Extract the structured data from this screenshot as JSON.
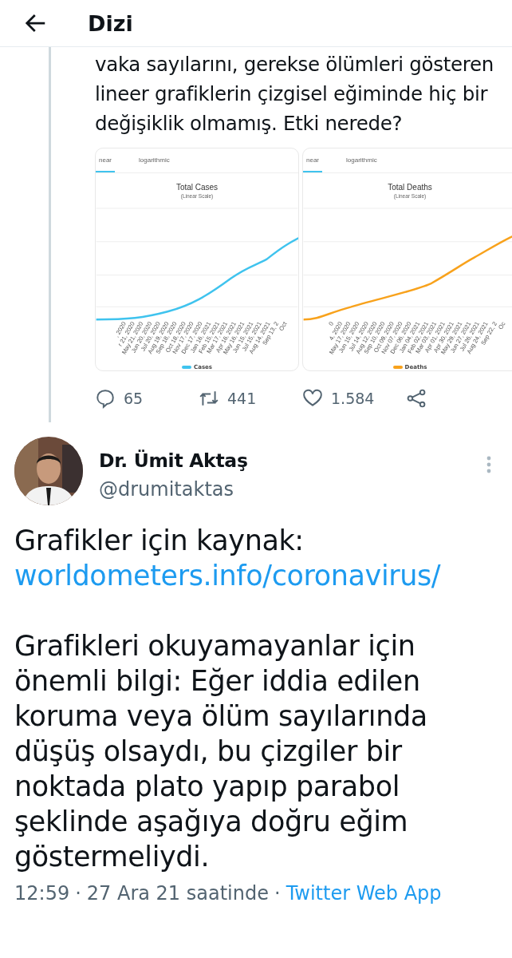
{
  "header": {
    "back_icon": true,
    "title": "Dizi"
  },
  "parent_tweet": {
    "text_lines": [
      "vaka sayılarını, gerekse ölümleri gösteren",
      "lineer grafiklerin çizgisel eğiminde hiç bir",
      "değişiklik olmamış.  Etki nerede?"
    ],
    "images": [
      {
        "tabs": [
          {
            "label": "near",
            "selected": true
          },
          {
            "label": "logarithmic",
            "selected": false
          }
        ],
        "title": "Total Cases",
        "subtitle": "(Linear Scale)",
        "color": "#3fc3ee",
        "dates": [
          ", 2020",
          "r 21, 2020",
          "May 21, 2020",
          "Jun 20, 2020",
          "Jul 20, 2020",
          "Aug 19, 2020",
          "Sep 18, 2020",
          "Oct 18, 2020",
          "Nov 17, 2020",
          "Dec 17, 2020",
          "Jan 16, 2021",
          "Feb 15, 2021",
          "Mar 17, 2021",
          "Apr 16, 2021",
          "May 16, 2021",
          "Jun 15, 2021",
          "Jul 15, 2021",
          "Aug 14, 2021",
          "Sep 13, 2",
          "Oct"
        ],
        "legend": "Cases"
      },
      {
        "tabs": [
          {
            "label": "near",
            "selected": true
          },
          {
            "label": "logarithmic",
            "selected": false
          }
        ],
        "title": "Total Deaths",
        "subtitle": "(Linear Scale)",
        "color": "#f8a21c",
        "dates": [
          "0",
          "4, 2020",
          "May 17, 2020",
          "Jun 15, 2020",
          "Jul 14, 2020",
          "Aug 12, 2020",
          "Sep 10, 2020",
          "Oct 09, 2020",
          "Nov 07, 2020",
          "Dec 06, 2020",
          "Jan 04, 2021",
          "Feb 02, 2021",
          "Mar 03, 2021",
          "Apr 01, 2021",
          "Apr 30, 2021",
          "May 29, 2021",
          "Jun 27, 2021",
          "Jul 26, 2021",
          "Aug 24, 2021",
          "Sep 22, 2",
          "Oc"
        ],
        "legend": "Deaths"
      }
    ],
    "actions": [
      {
        "kind": "reply",
        "count": "65"
      },
      {
        "kind": "retweet",
        "count": "441"
      },
      {
        "kind": "like",
        "count": "1.584"
      },
      {
        "kind": "share"
      }
    ]
  },
  "tweet": {
    "author": "Dr. Ümit Aktaş",
    "handle": "@drumitaktas",
    "paragraphs": [
      {
        "text": "Grafikler için kaynak:",
        "link": "worldometers.info/coronavirus/"
      },
      {
        "text": "Grafikleri okuyamayanlar için önemli bilgi: Eğer iddia edilen koruma veya ölüm sayılarında düşüş olsaydı, bu çizgiler bir noktada plato yapıp parabol şeklinde aşağıya doğru eğim göstermeliydi."
      }
    ],
    "meta": [
      {
        "kind": "time",
        "text": "12:59"
      },
      {
        "kind": "separator",
        "text": "·"
      },
      {
        "kind": "date",
        "text": "27 Ara 21 saatinde"
      },
      {
        "kind": "separator",
        "text": "·"
      },
      {
        "kind": "source",
        "text": "Twitter Web App"
      }
    ]
  }
}
